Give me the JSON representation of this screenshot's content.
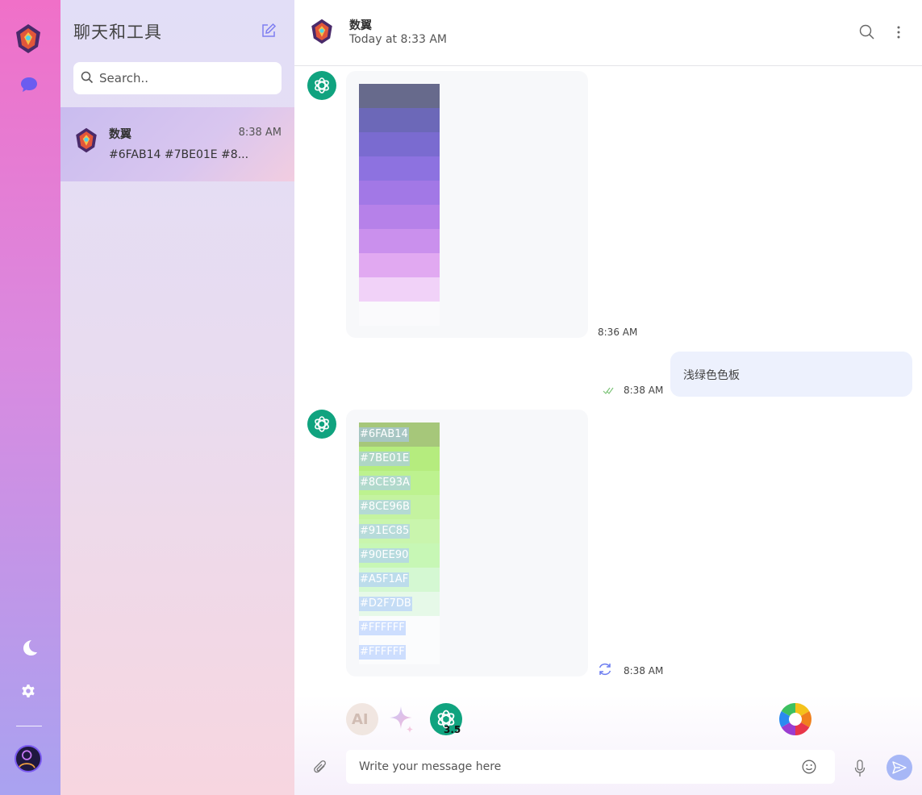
{
  "sidebar": {
    "title": "聊天和工具",
    "search_placeholder": "Search..",
    "conversations": [
      {
        "name": "数翼",
        "time": "8:38 AM",
        "preview": "#6FAB14 #7BE01E #8..."
      }
    ]
  },
  "header": {
    "name": "数翼",
    "status": "Today at 8:33 AM"
  },
  "messages": [
    {
      "from": "bot",
      "time": "8:36 AM",
      "swatches": [
        {
          "color": "#676a8c"
        },
        {
          "color": "#6c68b8"
        },
        {
          "color": "#7a6bd0"
        },
        {
          "color": "#8d72e0"
        },
        {
          "color": "#a278e6"
        },
        {
          "color": "#b681e9"
        },
        {
          "color": "#ca90ed"
        },
        {
          "color": "#e1a9f1"
        },
        {
          "color": "#f1d2f8"
        },
        {
          "color": "#fafafc"
        }
      ]
    },
    {
      "from": "user",
      "time": "8:38 AM",
      "text": "浅绿色色板"
    },
    {
      "from": "bot",
      "time": "8:38 AM",
      "swatches": [
        {
          "color": "#a6c77a",
          "label": "#6FAB14"
        },
        {
          "color": "#b5ec7e",
          "label": "#7BE01E"
        },
        {
          "color": "#bdf28f",
          "label": "#8CE93A"
        },
        {
          "color": "#c4f3a0",
          "label": "#8CE96B"
        },
        {
          "color": "#c9f5ad",
          "label": "#91EC85"
        },
        {
          "color": "#c7f7b5",
          "label": "#90EE90"
        },
        {
          "color": "#d4f8d2",
          "label": "#A5F1AF"
        },
        {
          "color": "#e6f9e8",
          "label": "#D2F7DB"
        },
        {
          "color": "#fbfcfd",
          "label": "#FFFFFF"
        },
        {
          "color": "#fbfcfd",
          "label": "#FFFFFF"
        }
      ]
    }
  ],
  "composer": {
    "placeholder": "Write your message here",
    "gpt_version": "3.5",
    "ai_label": "AI"
  },
  "colors": {
    "accent": "#a7b7f6",
    "bot": "#10a37f",
    "rail_top": "#f070c8",
    "rail_bottom": "#a9a2f0"
  },
  "icons": [
    "logo-icon",
    "chat-icon",
    "moon-icon",
    "gear-icon",
    "compose-icon",
    "search-icon",
    "more-icon",
    "check-icon",
    "refresh-icon",
    "paperclip-icon",
    "emoji-icon",
    "mic-icon",
    "send-icon"
  ]
}
